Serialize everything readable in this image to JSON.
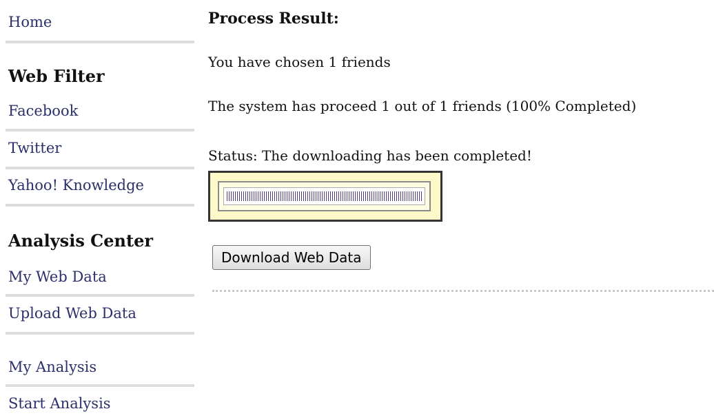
{
  "sidebar": {
    "home": "Home",
    "web_filter": {
      "title": "Web Filter",
      "items": [
        "Facebook",
        "Twitter",
        "Yahoo! Knowledge"
      ]
    },
    "analysis_center": {
      "title": "Analysis Center",
      "items": [
        "My Web Data",
        "Upload Web Data",
        "My Analysis",
        "Start Analysis"
      ]
    }
  },
  "main": {
    "title": "Process Result:",
    "chosen_text": "You have chosen 1 friends",
    "progress_text": "The system has proceed 1 out of 1 friends (100% Completed)",
    "status_text": "Status: The downloading has been completed!",
    "progress_fraction": 1.0,
    "download_button": "Download Web Data"
  }
}
